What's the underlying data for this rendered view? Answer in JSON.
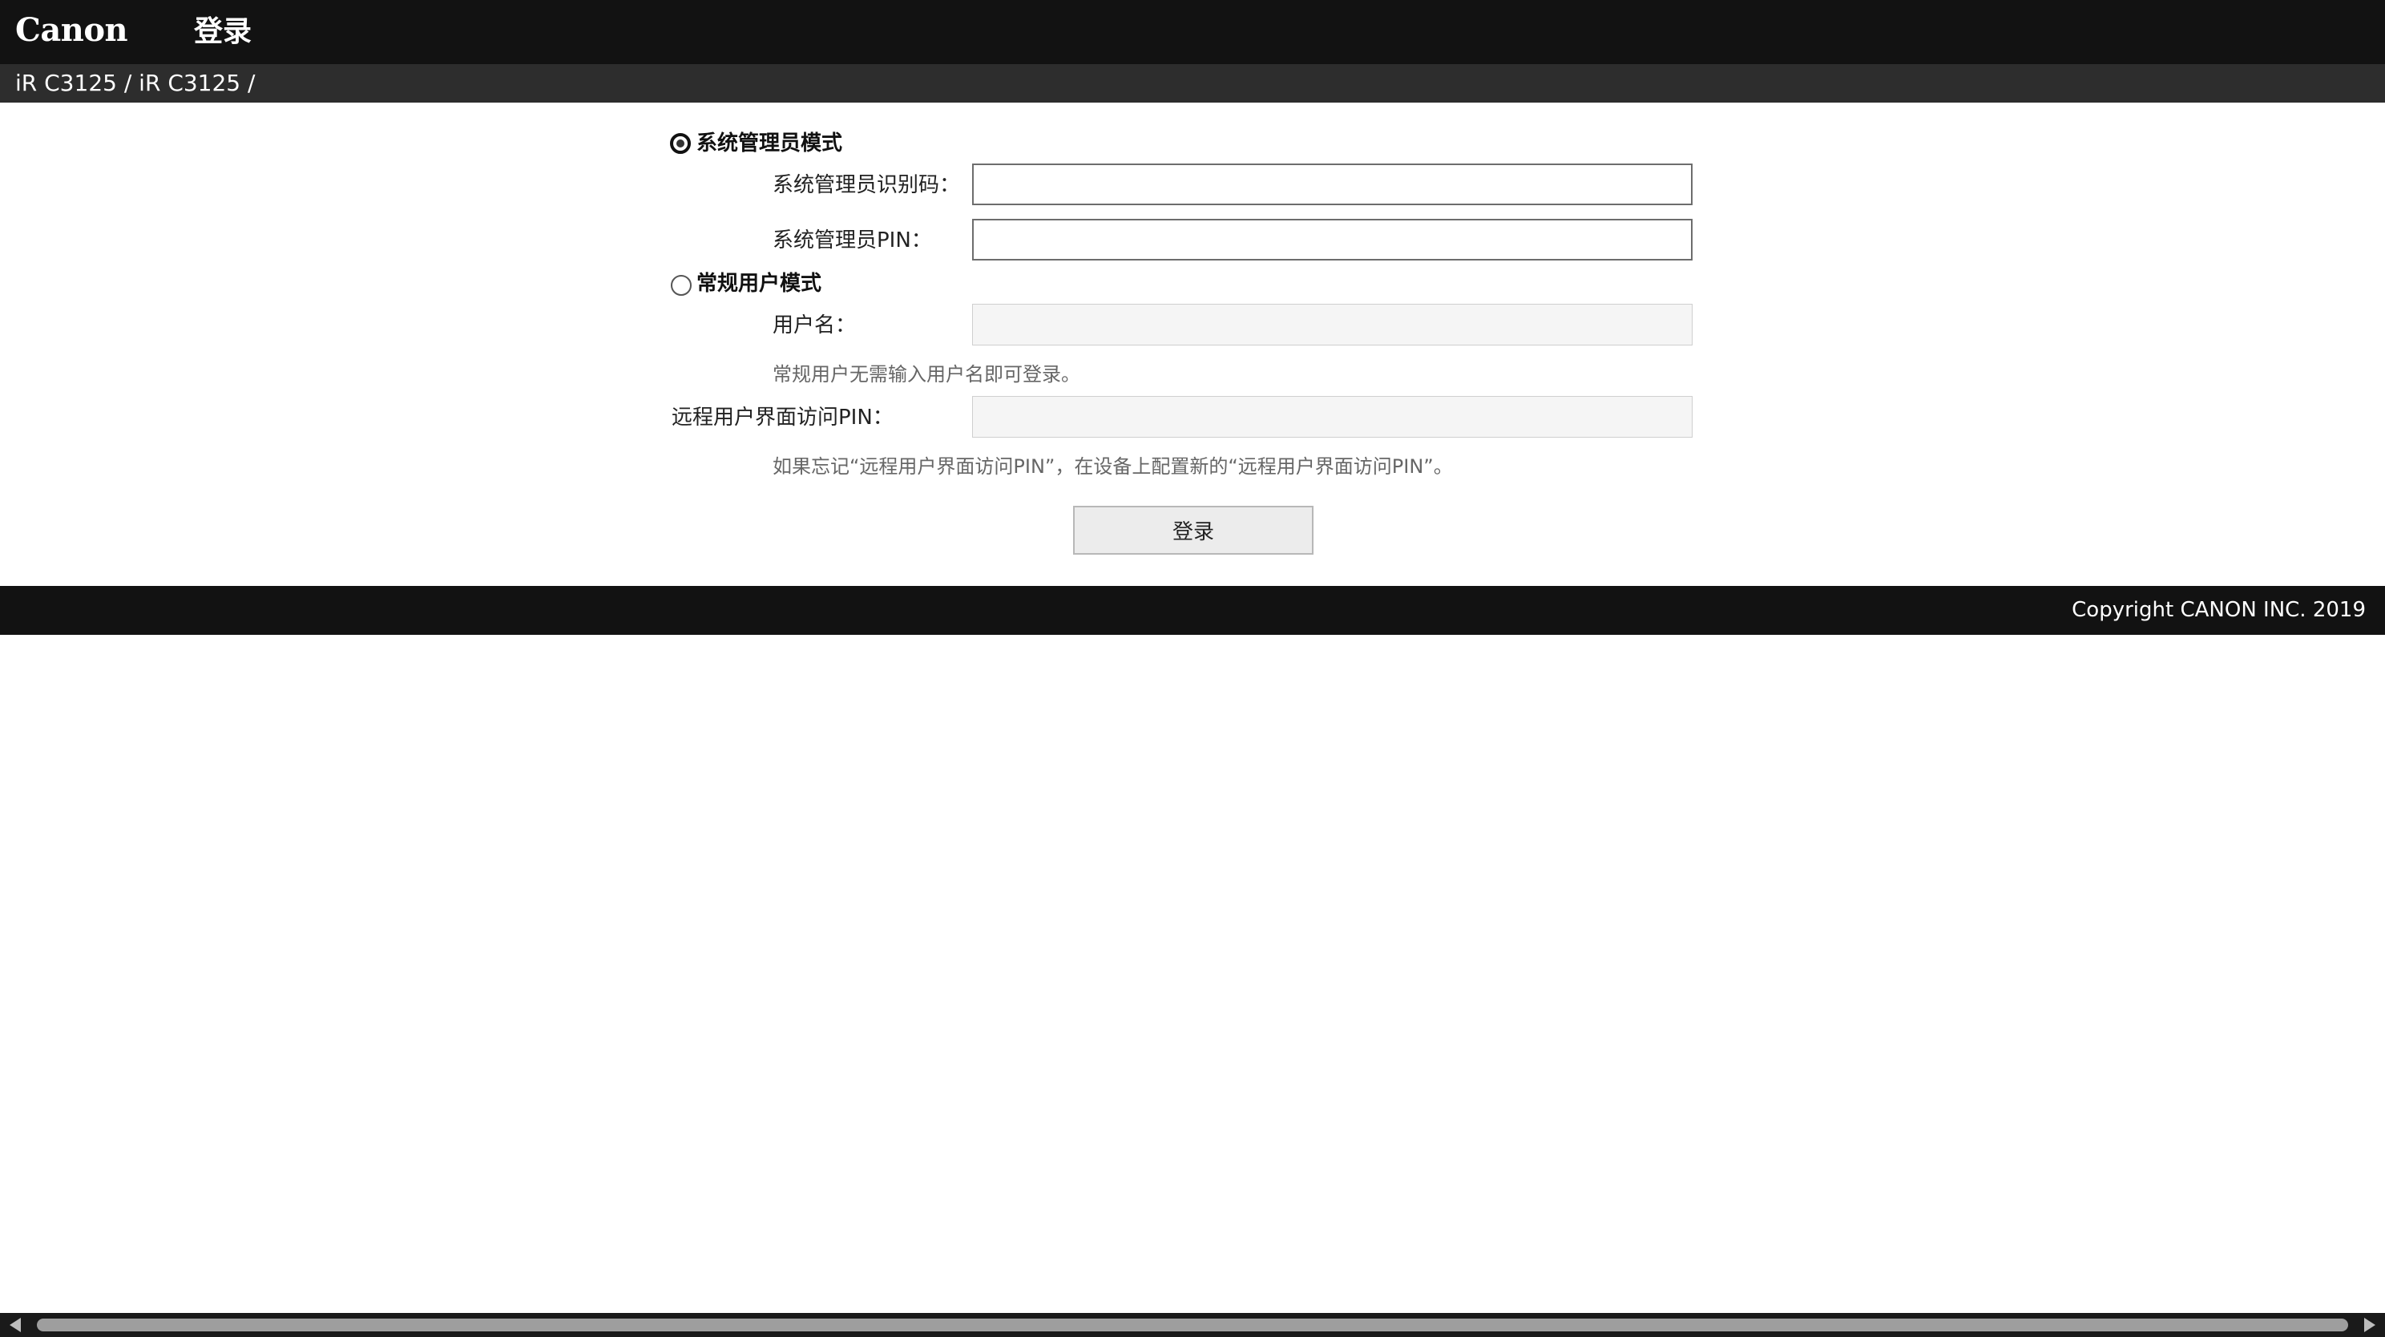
{
  "header": {
    "logo_text": "Canon",
    "title": "登录"
  },
  "breadcrumb": {
    "path": "iR C3125 / iR C3125 /"
  },
  "form": {
    "admin_mode": {
      "label": "系统管理员模式",
      "selected": true,
      "id_label": "系统管理员识别码：",
      "id_value": "",
      "pin_label": "系统管理员PIN：",
      "pin_value": ""
    },
    "general_mode": {
      "label": "常规用户模式",
      "selected": false,
      "username_label": "用户名：",
      "username_value": "",
      "hint": "常规用户无需输入用户名即可登录。"
    },
    "remote_ui_pin": {
      "label": "远程用户界面访问PIN：",
      "value": "",
      "hint": "如果忘记“远程用户界面访问PIN”，在设备上配置新的“远程用户界面访问PIN”。"
    },
    "login_button": "登录"
  },
  "footer": {
    "copyright": "Copyright CANON INC. 2019"
  }
}
